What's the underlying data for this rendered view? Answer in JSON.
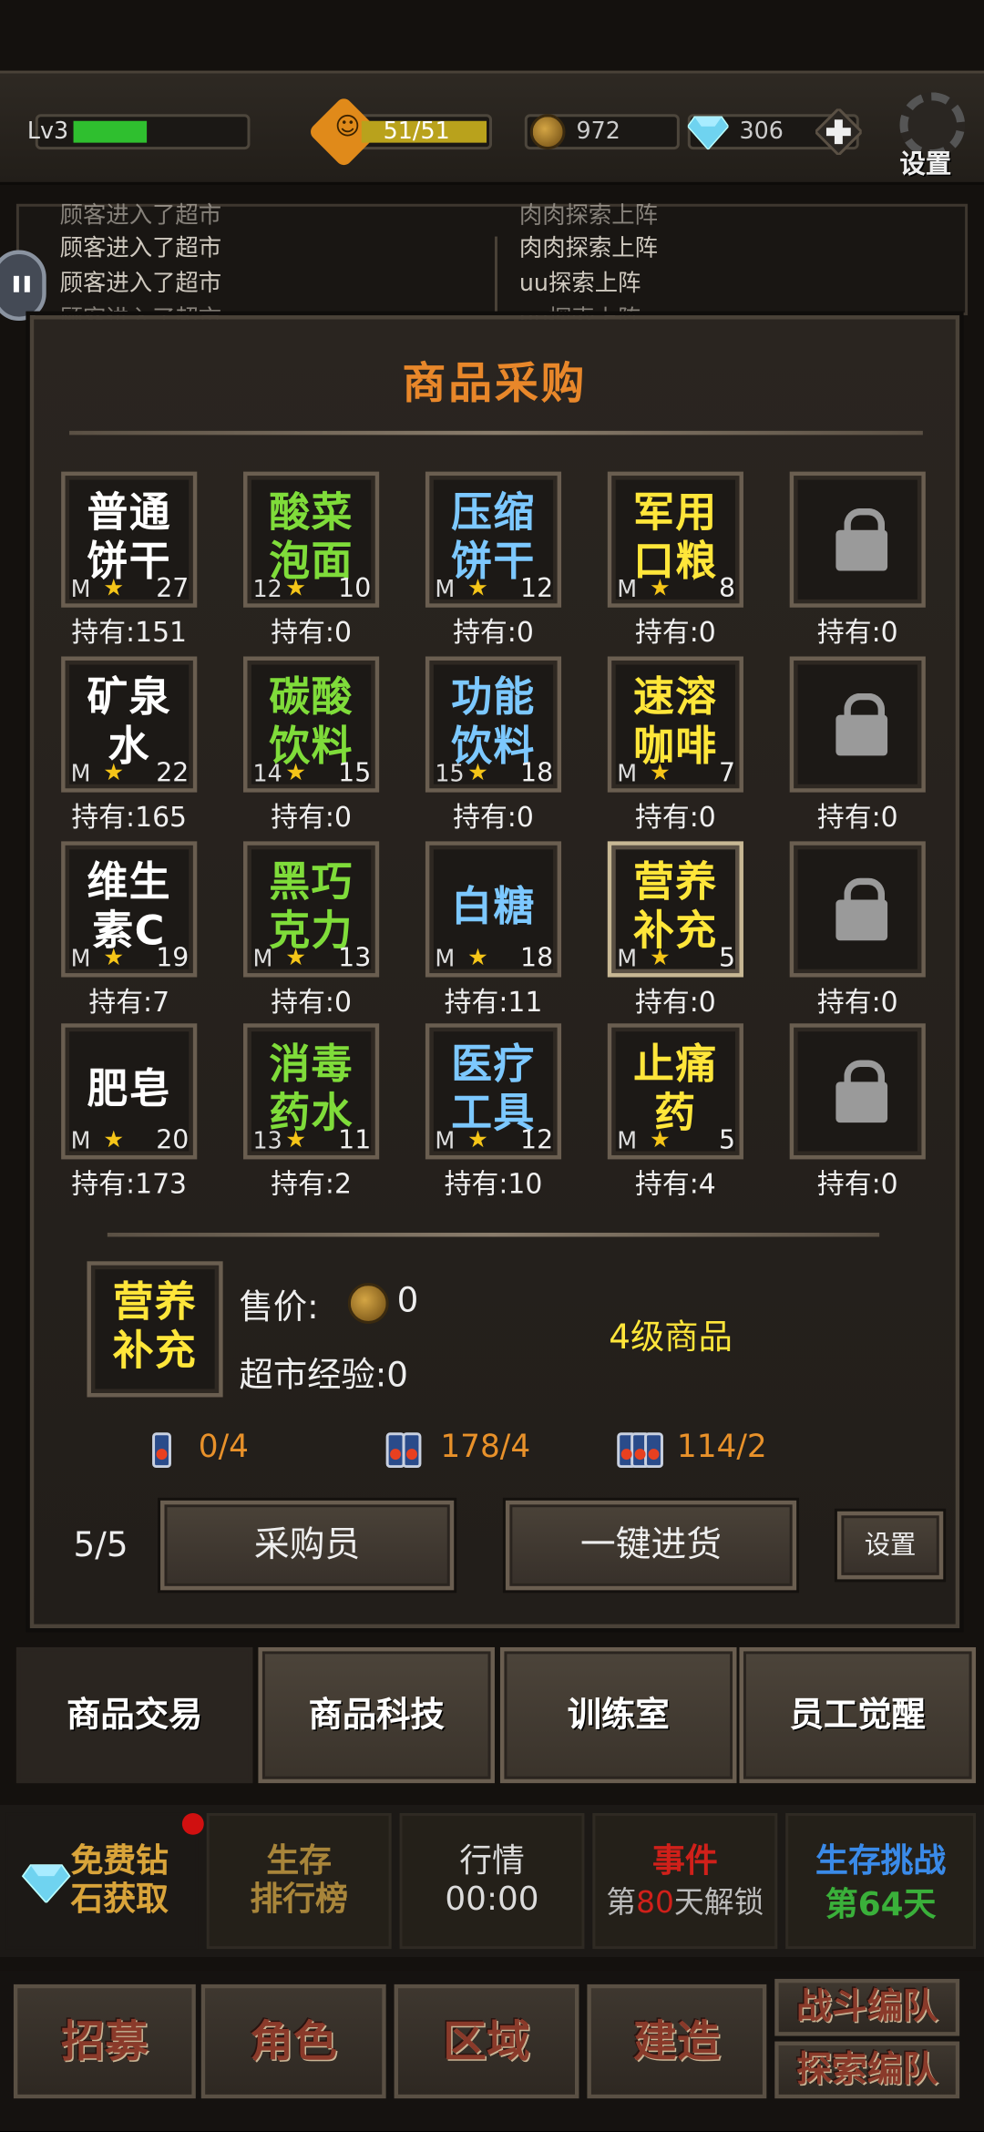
{
  "topbar": {
    "level_label": "Lv3",
    "level_progress": 0.42,
    "stamina_text": "51/51",
    "coins": "972",
    "gems": "306",
    "settings_label": "设置"
  },
  "log": {
    "left": [
      "顾客进入了超市",
      "顾客进入了超市",
      "顾客进入了超市",
      "顾客进入了超市"
    ],
    "right": [
      "肉肉探索上阵",
      "肉肉探索上阵",
      "uu探索上阵",
      "uu探索上阵"
    ]
  },
  "panel": {
    "title": "商品采购",
    "items": [
      {
        "l1": "普通",
        "l2": "饼干",
        "color": "#ffffff",
        "m": "M",
        "count": "27",
        "owned": "持有:151"
      },
      {
        "l1": "酸菜",
        "l2": "泡面",
        "color": "#7fdc3a",
        "m": "12",
        "count": "10",
        "owned": "持有:0"
      },
      {
        "l1": "压缩",
        "l2": "饼干",
        "color": "#7cc8ff",
        "m": "M",
        "count": "12",
        "owned": "持有:0"
      },
      {
        "l1": "军用",
        "l2": "口粮",
        "color": "#ffe63a",
        "m": "M",
        "count": "8",
        "owned": "持有:0"
      },
      {
        "locked": true,
        "owned": "持有:0"
      },
      {
        "l1": "矿泉",
        "l2": "水",
        "color": "#ffffff",
        "m": "M",
        "count": "22",
        "owned": "持有:165"
      },
      {
        "l1": "碳酸",
        "l2": "饮料",
        "color": "#7fdc3a",
        "m": "14",
        "count": "15",
        "owned": "持有:0"
      },
      {
        "l1": "功能",
        "l2": "饮料",
        "color": "#7cc8ff",
        "m": "15",
        "count": "18",
        "owned": "持有:0"
      },
      {
        "l1": "速溶",
        "l2": "咖啡",
        "color": "#ffe63a",
        "m": "M",
        "count": "7",
        "owned": "持有:0"
      },
      {
        "locked": true,
        "owned": "持有:0"
      },
      {
        "l1": "维生",
        "l2": "素C",
        "color": "#ffffff",
        "m": "M",
        "count": "19",
        "owned": "持有:7"
      },
      {
        "l1": "黑巧",
        "l2": "克力",
        "color": "#7fdc3a",
        "m": "M",
        "count": "13",
        "owned": "持有:0"
      },
      {
        "l1": "白糖",
        "l2": "",
        "color": "#7cc8ff",
        "m": "M",
        "count": "18",
        "owned": "持有:11"
      },
      {
        "l1": "营养",
        "l2": "补充",
        "color": "#ffe63a",
        "m": "M",
        "count": "5",
        "owned": "持有:0",
        "selected": true
      },
      {
        "locked": true,
        "owned": "持有:0"
      },
      {
        "l1": "肥皂",
        "l2": "",
        "color": "#ffffff",
        "m": "M",
        "count": "20",
        "owned": "持有:173"
      },
      {
        "l1": "消毒",
        "l2": "药水",
        "color": "#7fdc3a",
        "m": "13",
        "count": "11",
        "owned": "持有:2"
      },
      {
        "l1": "医疗",
        "l2": "工具",
        "color": "#7cc8ff",
        "m": "M",
        "count": "12",
        "owned": "持有:10"
      },
      {
        "l1": "止痛",
        "l2": "药",
        "color": "#ffe63a",
        "m": "M",
        "count": "5",
        "owned": "持有:4"
      },
      {
        "locked": true,
        "owned": "持有:0"
      }
    ]
  },
  "detail": {
    "name_l1": "营养",
    "name_l2": "补充",
    "name_color": "#ffe63a",
    "price_label": "售价:",
    "price_value": "0",
    "exp_label": "超市经验:0",
    "grade": "4级商品",
    "tickets": [
      "0/4",
      "178/4",
      "114/2"
    ],
    "buyer_count": "5/5",
    "buyer_btn": "采购员",
    "restock_btn": "一键进货",
    "settings_btn": "设置"
  },
  "tabs": [
    "商品交易",
    "商品科技",
    "训练室",
    "员工觉醒"
  ],
  "dashboard": {
    "free_gems_l1": "免费钻",
    "free_gems_l2": "石获取",
    "rank_l1": "生存",
    "rank_l2": "排行榜",
    "market_l1": "行情",
    "market_l2": "00:00",
    "event_l1": "事件",
    "event_pre": "第",
    "event_day": "80",
    "event_post": "天解锁",
    "challenge_l1": "生存挑战",
    "challenge_l2": "第64天"
  },
  "nav": [
    "招募",
    "角色",
    "区域",
    "建造"
  ],
  "nav_right": [
    "战斗编队",
    "探索编队"
  ]
}
